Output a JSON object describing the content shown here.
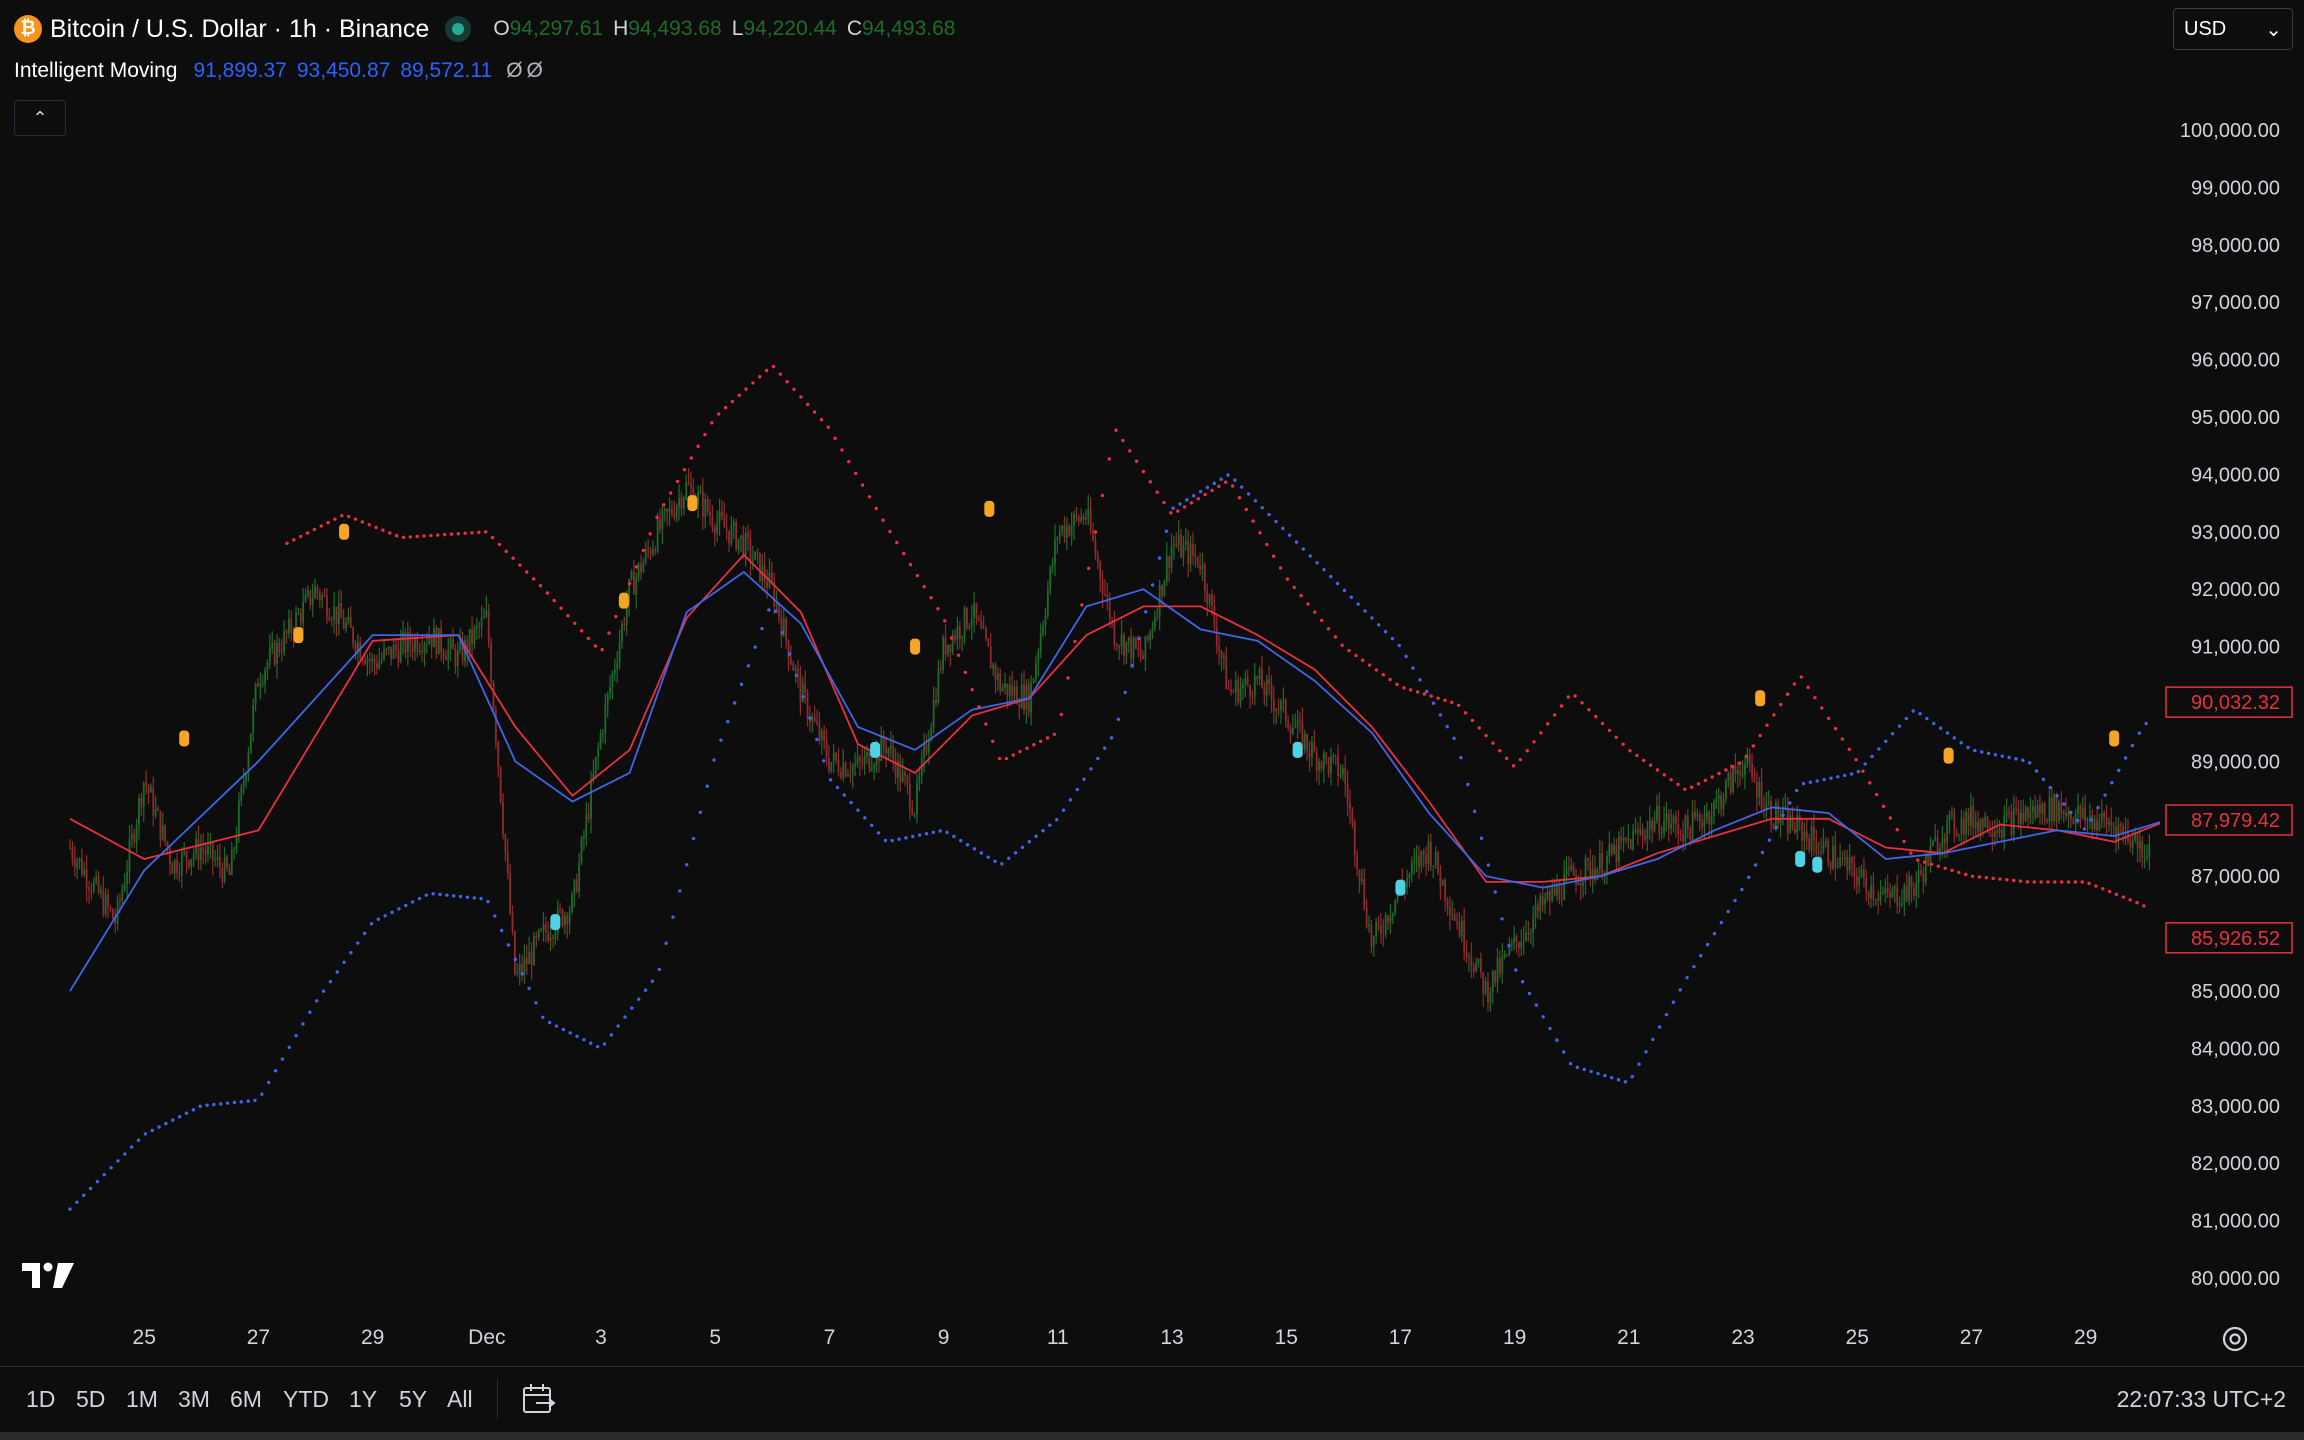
{
  "header": {
    "coin_glyph": "₿",
    "title": "Bitcoin / U.S. Dollar · 1h · Binance",
    "ohlc": [
      {
        "key": "O",
        "value": "94,297.61"
      },
      {
        "key": "H",
        "value": "94,493.68"
      },
      {
        "key": "L",
        "value": "94,220.44"
      },
      {
        "key": "C",
        "value": "94,493.68"
      }
    ],
    "currency": "USD",
    "currency_chevron": "⌄"
  },
  "indicator": {
    "name": "Intelligent Moving",
    "values": [
      "91,899.37",
      "93,450.87",
      "89,572.11"
    ],
    "nulls": [
      "Ø",
      "Ø"
    ]
  },
  "collapse_glyph": "⌃",
  "colors": {
    "background": "#0d0d0d",
    "up": "#1f6b2b",
    "down": "#8f2a2e",
    "band_upper_red": "#e8303f",
    "band_blue": "#3f66e8",
    "signal_orange": "#f6a623",
    "signal_cyan": "#4fd1e6",
    "axis_text": "#d1d4dc"
  },
  "time_axis": [
    "25",
    "27",
    "29",
    "Dec",
    "3",
    "5",
    "7",
    "9",
    "11",
    "13",
    "15",
    "17",
    "19",
    "21",
    "23",
    "25",
    "27",
    "29"
  ],
  "bottom_bar": {
    "ranges": [
      "1D",
      "5D",
      "1M",
      "3M",
      "6M",
      "YTD",
      "1Y",
      "5Y",
      "All"
    ],
    "clock": "22:07:33 UTC+2"
  },
  "chart_data": {
    "type": "line",
    "series_kind": "candlestick with 3 moving-band lines",
    "ylim": [
      80000,
      100000
    ],
    "y_ticks": [
      "80,000.00",
      "81,000.00",
      "82,000.00",
      "83,000.00",
      "84,000.00",
      "85,000.00",
      "86,000.00",
      "87,000.00",
      "88,000.00",
      "89,000.00",
      "90,000.00",
      "91,000.00",
      "92,000.00",
      "93,000.00",
      "94,000.00",
      "95,000.00",
      "96,000.00",
      "97,000.00",
      "98,000.00",
      "99,000.00",
      "100,000.00"
    ],
    "y_tick_values": [
      80000,
      81000,
      82000,
      83000,
      84000,
      85000,
      86000,
      87000,
      88000,
      89000,
      90000,
      91000,
      92000,
      93000,
      94000,
      95000,
      96000,
      97000,
      98000,
      99000,
      100000
    ],
    "x_ticks": [
      "25",
      "27",
      "29",
      "Dec",
      "3",
      "5",
      "7",
      "9",
      "11",
      "13",
      "15",
      "17",
      "19",
      "21",
      "23",
      "25",
      "27",
      "29"
    ],
    "x_tick_days": [
      -6,
      -4,
      -2,
      0,
      2,
      4,
      6,
      8,
      10,
      12,
      14,
      16,
      18,
      20,
      22,
      24,
      26,
      28
    ],
    "x_range_days": [
      -7.3,
      32
    ],
    "price_labels": [
      {
        "value": 90032.32,
        "text": "90,032.32",
        "color": "#e8303f"
      },
      {
        "value": 87979.42,
        "text": "87,979.42",
        "color": "#e8303f"
      },
      {
        "value": 85926.52,
        "text": "85,926.52",
        "color": "#e8303f"
      }
    ],
    "close": {
      "x": [
        -7.3,
        -6.5,
        -6,
        -5.5,
        -5,
        -4.5,
        -4,
        -3.5,
        -3,
        -2.5,
        -2,
        -1.5,
        -1,
        -0.5,
        0,
        0.5,
        1,
        1.5,
        2,
        2.5,
        3,
        3.5,
        4,
        4.5,
        5,
        5.5,
        6,
        6.5,
        7,
        7.5,
        8,
        8.5,
        9,
        9.5,
        10,
        10.5,
        11,
        11.5,
        12,
        12.5,
        13,
        13.5,
        14,
        14.5,
        15,
        15.5,
        16,
        16.5,
        17,
        17.5,
        18,
        18.5,
        19,
        19.5,
        20,
        20.5,
        21,
        21.5,
        22,
        22.5,
        23,
        23.5,
        24,
        24.5,
        25,
        25.5,
        26,
        26.5,
        27,
        27.5,
        28,
        28.5,
        29,
        29.5,
        30
      ],
      "y": [
        87500,
        86200,
        88700,
        87200,
        87500,
        87000,
        90500,
        91200,
        92000,
        91400,
        90700,
        91000,
        91200,
        90800,
        91500,
        85200,
        86000,
        86500,
        89500,
        92000,
        93000,
        93800,
        93200,
        92800,
        92000,
        90200,
        89000,
        88900,
        89300,
        88200,
        91000,
        91600,
        90300,
        90100,
        93000,
        93300,
        91200,
        90800,
        92800,
        92500,
        90200,
        90400,
        89800,
        89100,
        88800,
        85800,
        86800,
        87500,
        86200,
        85000,
        85800,
        86500,
        87000,
        87200,
        87600,
        88000,
        87800,
        88200,
        89000,
        88100,
        87800,
        87400,
        87000,
        86600,
        86800,
        87800,
        88000,
        87900,
        88100,
        88200,
        88000,
        87900,
        87500,
        87200,
        88400,
        88500,
        88000,
        88600,
        88300
      ]
    },
    "series": [
      {
        "color": "#e8303f",
        "x": [
          -7.3,
          -6,
          -4,
          -2,
          -0.5,
          0.5,
          1.5,
          2.5,
          3.5,
          4.5,
          5.5,
          6.5,
          7.5,
          8.5,
          9.5,
          10.5,
          11.5,
          12.5,
          13.5,
          14.5,
          15.5,
          16.5,
          17.5,
          18.5,
          19.5,
          20.5,
          21.5,
          22.5,
          23.5,
          24.5,
          25.5,
          26.5,
          27.5,
          28.5,
          29.5,
          30
        ],
        "y": [
          88000,
          87300,
          87800,
          91100,
          91200,
          89600,
          88400,
          89200,
          91500,
          92600,
          91600,
          89300,
          88800,
          89800,
          90100,
          91200,
          91700,
          91700,
          91200,
          90600,
          89600,
          88300,
          86900,
          86900,
          87000,
          87400,
          87700,
          88000,
          88000,
          87500,
          87400,
          87900,
          87800,
          87600,
          88000,
          87900
        ]
      },
      {
        "color": "#3f66e8",
        "x": [
          -7.3,
          -6,
          -4,
          -2,
          -0.5,
          0.5,
          1.5,
          2.5,
          3.5,
          4.5,
          5.5,
          6.5,
          7.5,
          8.5,
          9.5,
          10.5,
          11.5,
          12.5,
          13.5,
          14.5,
          15.5,
          16.5,
          17.5,
          18.5,
          19.5,
          20.5,
          21.5,
          22.5,
          23.5,
          24.5,
          25.5,
          26.5,
          27.5,
          28.5,
          29.5,
          30
        ],
        "y": [
          85000,
          87100,
          89000,
          91200,
          91200,
          89000,
          88300,
          88800,
          91600,
          92300,
          91400,
          89600,
          89200,
          89900,
          90100,
          91700,
          92000,
          91300,
          91100,
          90400,
          89500,
          88100,
          87000,
          86800,
          87000,
          87300,
          87800,
          88200,
          88100,
          87300,
          87400,
          87600,
          87800,
          87700,
          88000,
          88000
        ]
      },
      {
        "color": "#e8303f",
        "dotted": true,
        "x": [
          -3.5,
          -2.5,
          -1.5,
          0,
          1,
          2,
          3,
          4,
          5,
          6,
          7,
          8,
          9,
          10,
          11,
          12,
          13,
          14,
          15,
          16,
          17,
          18,
          19,
          20,
          21,
          22,
          23,
          24,
          25,
          26,
          27,
          28,
          29,
          30
        ],
        "y": [
          92800,
          93300,
          92900,
          93000,
          92000,
          90900,
          93300,
          95000,
          95900,
          94800,
          93100,
          91500,
          89000,
          89500,
          94800,
          93300,
          93900,
          92200,
          91000,
          90300,
          90000,
          88900,
          90200,
          89200,
          88500,
          89000,
          90500,
          89000,
          87300,
          87000,
          86900,
          86900,
          86500,
          85700
        ]
      },
      {
        "color": "#3f66e8",
        "dotted": true,
        "x": [
          -7.3,
          -6,
          -5,
          -4,
          -3,
          -2,
          -1,
          0,
          1,
          2,
          3,
          4,
          5,
          6,
          7,
          8,
          9,
          10,
          11,
          12,
          13,
          14,
          15,
          16,
          17,
          18,
          19,
          20,
          21,
          22,
          23,
          24,
          25,
          26,
          27,
          28,
          29,
          30
        ],
        "y": [
          81200,
          82500,
          83000,
          83100,
          84800,
          86200,
          86700,
          86600,
          84500,
          84000,
          85300,
          89100,
          91800,
          88700,
          87600,
          87800,
          87200,
          88000,
          89500,
          93400,
          94000,
          93000,
          92000,
          91000,
          89300,
          85400,
          83700,
          83400,
          85200,
          86800,
          88600,
          88800,
          89900,
          89200,
          89000,
          87800,
          89600,
          90600
        ]
      }
    ],
    "signals": [
      {
        "x": -5.3,
        "y": 89400,
        "color": "#f6a623"
      },
      {
        "x": -3.3,
        "y": 91200,
        "color": "#f6a623"
      },
      {
        "x": -2.5,
        "y": 93000,
        "color": "#f6a623"
      },
      {
        "x": 2.4,
        "y": 91800,
        "color": "#f6a623"
      },
      {
        "x": 3.6,
        "y": 93500,
        "color": "#f6a623"
      },
      {
        "x": 7.5,
        "y": 91000,
        "color": "#f6a623"
      },
      {
        "x": 8.8,
        "y": 93400,
        "color": "#f6a623"
      },
      {
        "x": 22.3,
        "y": 90100,
        "color": "#f6a623"
      },
      {
        "x": 25.6,
        "y": 89100,
        "color": "#f6a623"
      },
      {
        "x": 28.5,
        "y": 89400,
        "color": "#f6a623"
      },
      {
        "x": 1.2,
        "y": 86200,
        "color": "#4fd1e6"
      },
      {
        "x": 6.8,
        "y": 89200,
        "color": "#4fd1e6"
      },
      {
        "x": 14.2,
        "y": 89200,
        "color": "#4fd1e6"
      },
      {
        "x": 16.0,
        "y": 86800,
        "color": "#4fd1e6"
      },
      {
        "x": 23.0,
        "y": 87300,
        "color": "#4fd1e6"
      },
      {
        "x": 23.3,
        "y": 87200,
        "color": "#4fd1e6"
      }
    ]
  }
}
